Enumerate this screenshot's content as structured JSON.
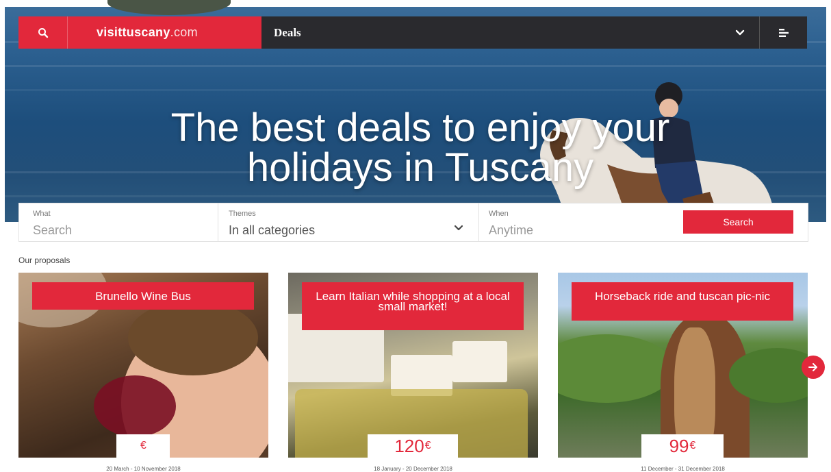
{
  "nav": {
    "logo_bold": "visittuscany",
    "logo_light": ".com",
    "section": "Deals"
  },
  "hero": {
    "title_line1": "The best deals to enjoy your",
    "title_line2": "holidays in Tuscany"
  },
  "search": {
    "what_label": "What",
    "what_placeholder": "Search",
    "themes_label": "Themes",
    "themes_value": "In all categories",
    "when_label": "When",
    "when_placeholder": "Anytime",
    "button_label": "Search"
  },
  "proposals": {
    "heading": "Our proposals",
    "cards": [
      {
        "title": "Brunello Wine Bus",
        "price": "",
        "currency": "€",
        "dates": "20 March - 10 November 2018"
      },
      {
        "title": "Learn Italian while shopping at a local small market!",
        "price": "120",
        "currency": "€",
        "dates": "18 January - 20 December 2018"
      },
      {
        "title": "Horseback ride and tuscan pic-nic",
        "price": "99",
        "currency": "€",
        "dates": "11 December - 31 December 2018"
      }
    ]
  },
  "colors": {
    "accent": "#e2283b",
    "nav_dark": "#2a2a2e"
  },
  "icons": {
    "search": "search-icon",
    "chevron": "chevron-down-icon",
    "menu": "menu-icon",
    "next": "arrow-right-icon"
  }
}
